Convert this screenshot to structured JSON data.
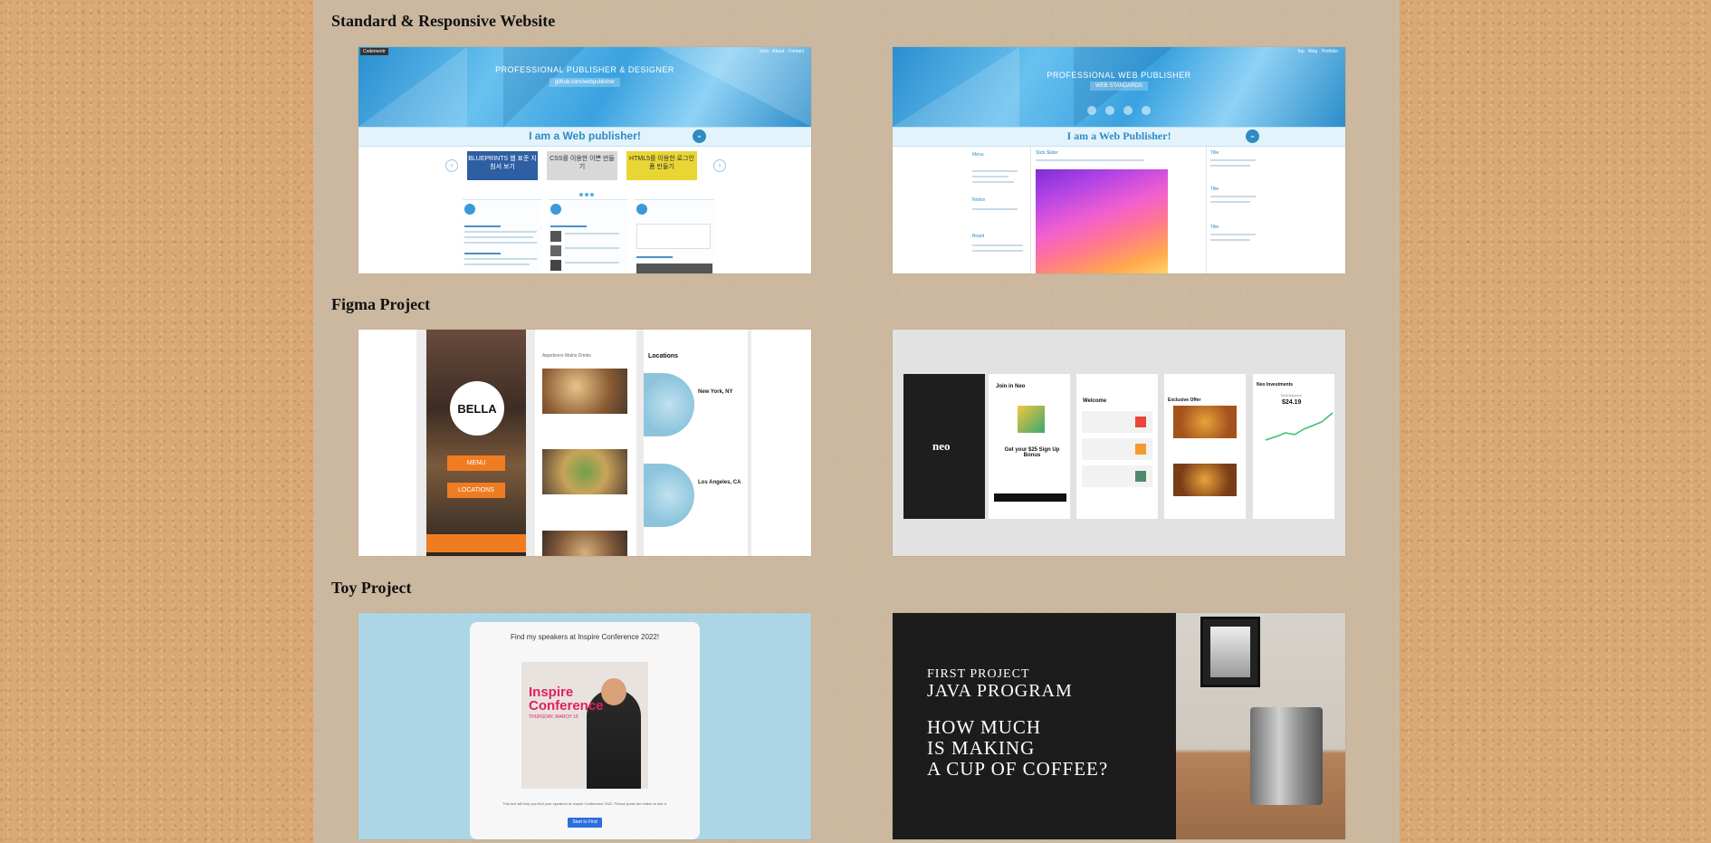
{
  "sections": [
    {
      "title": "Standard & Responsive Website",
      "cards": [
        {
          "tag": "Codementr",
          "nav": "Intro · About · Contact",
          "hero_title": "PROFESSIONAL PUBLISHER & DESIGNER",
          "hero_sub": "github.com/webpublisher",
          "band_text": "I am a Web publisher!",
          "slides": [
            "BLUEPRINTS 웹 표준 지침서 보기",
            "CSS를 이용한 이쁜 만들기",
            "HTML5를 이용한 로그인 폼 만들기"
          ]
        },
        {
          "nav": "Top · Blog · Portfolio",
          "hero_title": "PROFESSIONAL WEB PUBLISHER",
          "hero_sub": "WEB STANDARDS",
          "band_text": "I am a Web Publisher!",
          "left_labels": [
            "Menu",
            "Notice",
            "Board"
          ],
          "center_label": "Slick Slider",
          "right_labels": [
            "Title",
            "Title",
            "Title"
          ]
        }
      ]
    },
    {
      "title": "Figma Project",
      "cards": [
        {
          "logo": "BELLA",
          "buttons": [
            "MENU",
            "LOCATIONS"
          ],
          "tabs": "Appetizers   Mains   Drinks",
          "locations_title": "Locations",
          "cities": [
            "New York, NY",
            "Los Angeles, CA"
          ]
        },
        {
          "logo": "neo",
          "join_title": "Join in Neo",
          "bonus": "Get your $25 Sign Up Bonus",
          "welcome": "Welcome",
          "offer": "Exclusive Offer",
          "investments": "Neo Investments",
          "balance_label": "Total Balance",
          "balance": "$24.19"
        }
      ]
    },
    {
      "title": "Toy Project",
      "cards": [
        {
          "heading": "Find my speakers at Inspire Conference 2022!",
          "poster_line1": "Inspire",
          "poster_line2": "Conference",
          "poster_date": "THURSDAY, MARCH 10",
          "note": "This tool will help you find your speakers at Inspire Conference 2022. Please press the button to see it.",
          "button": "Start to Find"
        },
        {
          "line1": "FIRST PROJECT",
          "line2": "JAVA PROGRAM",
          "line3": "HOW MUCH",
          "line4": "IS MAKING",
          "line5": "A CUP OF COFFEE?"
        }
      ]
    }
  ],
  "colors": {
    "panel": "#c8b9a5",
    "background": "#d9a874",
    "accent_blue": "#2d8cc3",
    "accent_orange": "#f07c22",
    "conference_pink": "#e2205e"
  }
}
